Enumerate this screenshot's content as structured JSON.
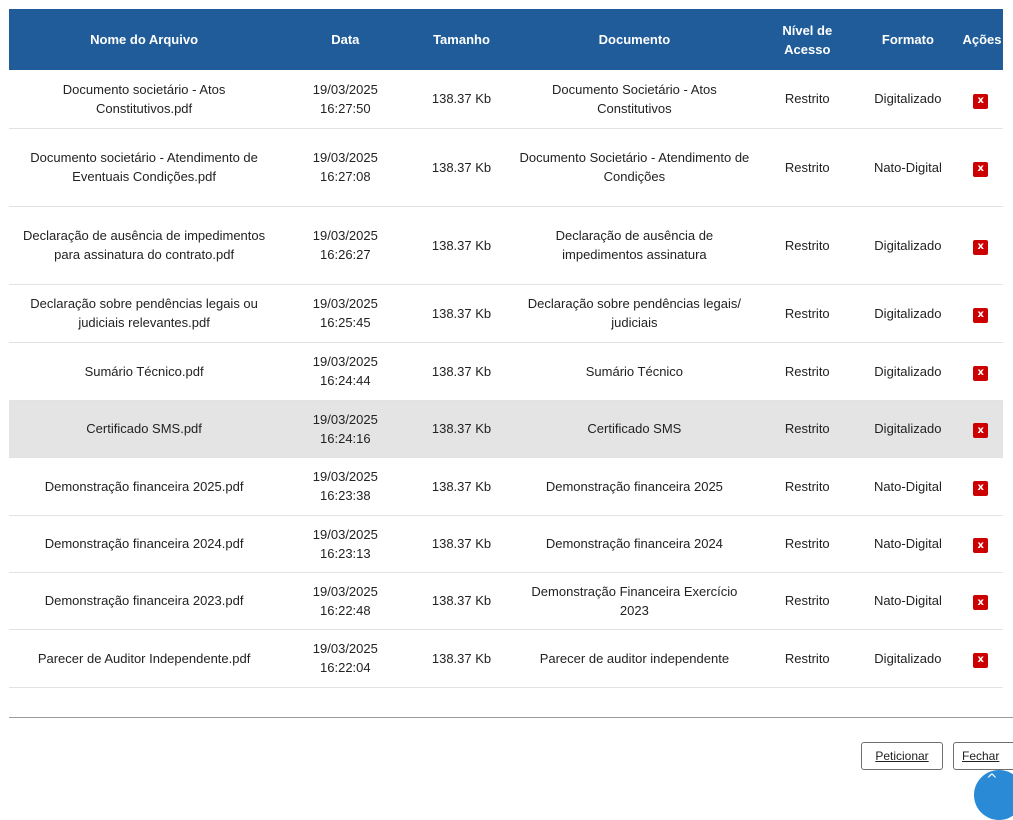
{
  "table": {
    "headers": {
      "nome": "Nome do Arquivo",
      "data": "Data",
      "tamanho": "Tamanho",
      "documento": "Documento",
      "nivel_line1": "Nível de",
      "nivel_line2": "Acesso",
      "formato": "Formato",
      "acoes": "Ações"
    },
    "rows": [
      {
        "nome": "Documento societário - Atos Constitutivos.pdf",
        "data": "19/03/2025",
        "hora": "16:27:50",
        "tamanho": "138.37 Kb",
        "documento": "Documento Societário - Atos Constitutivos",
        "nivel": "Restrito",
        "formato": "Digitalizado"
      },
      {
        "nome": "Documento societário - Atendimento de Eventuais Condições.pdf",
        "data": "19/03/2025",
        "hora": "16:27:08",
        "tamanho": "138.37 Kb",
        "documento": "Documento Societário - Atendimento de Condições",
        "nivel": "Restrito",
        "formato": "Nato-Digital"
      },
      {
        "nome": "Declaração de ausência de impedimentos para assinatura do contrato.pdf",
        "data": "19/03/2025",
        "hora": "16:26:27",
        "tamanho": "138.37 Kb",
        "documento": "Declaração de ausência de impedimentos assinatura",
        "nivel": "Restrito",
        "formato": "Digitalizado"
      },
      {
        "nome": "Declaração sobre pendências legais ou judiciais relevantes.pdf",
        "data": "19/03/2025",
        "hora": "16:25:45",
        "tamanho": "138.37 Kb",
        "documento": "Declaração sobre pendências legais/ judiciais",
        "nivel": "Restrito",
        "formato": "Digitalizado"
      },
      {
        "nome": "Sumário Técnico.pdf",
        "data": "19/03/2025",
        "hora": "16:24:44",
        "tamanho": "138.37 Kb",
        "documento": "Sumário Técnico",
        "nivel": "Restrito",
        "formato": "Digitalizado"
      },
      {
        "nome": "Certificado SMS.pdf",
        "data": "19/03/2025",
        "hora": "16:24:16",
        "tamanho": "138.37 Kb",
        "documento": "Certificado SMS",
        "nivel": "Restrito",
        "formato": "Digitalizado",
        "selected": true
      },
      {
        "nome": "Demonstração financeira 2025.pdf",
        "data": "19/03/2025",
        "hora": "16:23:38",
        "tamanho": "138.37 Kb",
        "documento": "Demonstração financeira 2025",
        "nivel": "Restrito",
        "formato": "Nato-Digital"
      },
      {
        "nome": "Demonstração financeira 2024.pdf",
        "data": "19/03/2025",
        "hora": "16:23:13",
        "tamanho": "138.37 Kb",
        "documento": "Demonstração financeira 2024",
        "nivel": "Restrito",
        "formato": "Nato-Digital"
      },
      {
        "nome": "Demonstração financeira 2023.pdf",
        "data": "19/03/2025",
        "hora": "16:22:48",
        "tamanho": "138.37 Kb",
        "documento": "Demonstração Financeira Exercício 2023",
        "nivel": "Restrito",
        "formato": "Nato-Digital"
      },
      {
        "nome": "Parecer de Auditor Independente.pdf",
        "data": "19/03/2025",
        "hora": "16:22:04",
        "tamanho": "138.37 Kb",
        "documento": "Parecer de auditor independente",
        "nivel": "Restrito",
        "formato": "Digitalizado"
      }
    ],
    "delete_icon": "close-icon",
    "delete_glyph": "x",
    "delete_color": "#cc0000",
    "header_color": "#1f5c99"
  },
  "actions": {
    "peticionar_label": "Peticionar",
    "fechar_label": "Fechar"
  },
  "scroll_top_icon": "arrow-up-icon",
  "scroll_top_glyph": "^"
}
